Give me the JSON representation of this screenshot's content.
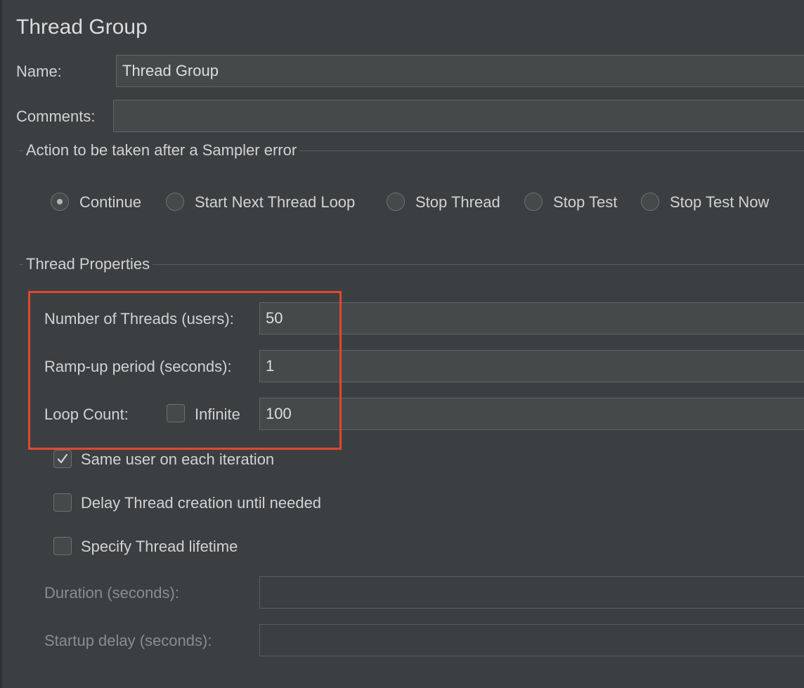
{
  "title": "Thread Group",
  "name_field": {
    "label": "Name:",
    "value": "Thread Group"
  },
  "comments_field": {
    "label": "Comments:",
    "value": ""
  },
  "sampler_error": {
    "title": "Action to be taken after a Sampler error",
    "options": [
      {
        "label": "Continue",
        "selected": true
      },
      {
        "label": "Start Next Thread Loop",
        "selected": false
      },
      {
        "label": "Stop Thread",
        "selected": false
      },
      {
        "label": "Stop Test",
        "selected": false
      },
      {
        "label": "Stop Test Now",
        "selected": false
      }
    ]
  },
  "thread_properties": {
    "title": "Thread Properties",
    "num_threads": {
      "label": "Number of Threads (users):",
      "value": "50"
    },
    "ramp_up": {
      "label": "Ramp-up period (seconds):",
      "value": "1"
    },
    "loop_count": {
      "label": "Loop Count:",
      "infinite_label": "Infinite",
      "infinite_checked": false,
      "value": "100"
    },
    "same_user": {
      "label": "Same user on each iteration",
      "checked": true
    },
    "delay_creation": {
      "label": "Delay Thread creation until needed",
      "checked": false
    },
    "specify_lifetime": {
      "label": "Specify Thread lifetime",
      "checked": false
    },
    "duration": {
      "label": "Duration (seconds):",
      "value": ""
    },
    "startup_delay": {
      "label": "Startup delay (seconds):",
      "value": ""
    }
  },
  "colors": {
    "background": "#3c3f41",
    "field_background": "#45494a",
    "highlight": "#e2472f",
    "text": "#d2d2d2",
    "disabled_text": "#8a8c8e"
  }
}
